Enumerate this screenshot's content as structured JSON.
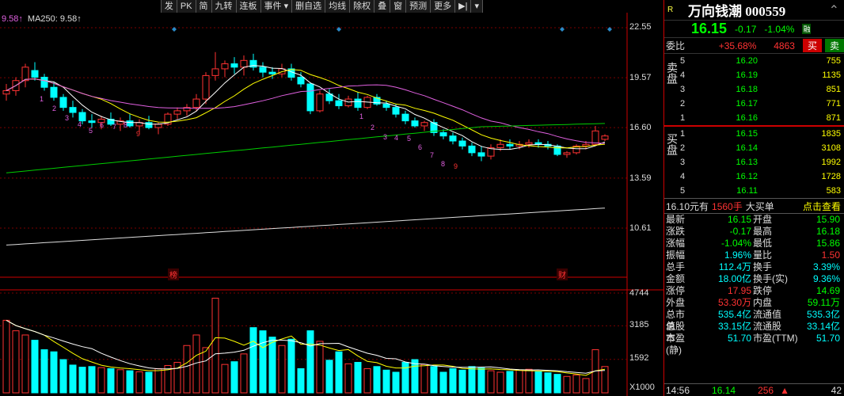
{
  "toolbar": [
    "发",
    "PK",
    "简",
    "九转",
    "连板",
    "事件",
    "删自选",
    "均线",
    "除权",
    "叠",
    "窗",
    "预测",
    "更多"
  ],
  "legend": {
    "ma": "9.58↑",
    "ma250": "MA250: 9.58↑"
  },
  "yaxis_price": [
    "22.55",
    "19.57",
    "16.60",
    "13.59",
    "10.61"
  ],
  "yaxis_vol": [
    "4744",
    "3185",
    "1592",
    "X1000"
  ],
  "markers": {
    "bang": "榜",
    "cai": "财"
  },
  "counts_a": [
    "1",
    "2",
    "3",
    "4",
    "5",
    "6",
    "7",
    "8",
    "9"
  ],
  "counts_b": [
    "1",
    "2",
    "3",
    "4",
    "5",
    "6",
    "7",
    "8",
    "9"
  ],
  "chart_data": {
    "type": "candlestick",
    "candles": [
      [
        18.6,
        19.2,
        18.2,
        18.8
      ],
      [
        18.8,
        19.6,
        18.5,
        19.4
      ],
      [
        19.4,
        20.4,
        19.0,
        20.2
      ],
      [
        20.0,
        20.5,
        19.4,
        19.6
      ],
      [
        19.6,
        19.8,
        18.8,
        19.0
      ],
      [
        19.0,
        19.3,
        18.2,
        18.4
      ],
      [
        18.4,
        18.6,
        17.6,
        17.8
      ],
      [
        17.8,
        18.2,
        17.2,
        17.5
      ],
      [
        17.5,
        17.7,
        16.8,
        17.0
      ],
      [
        17.0,
        17.4,
        16.6,
        16.9
      ],
      [
        16.9,
        17.3,
        16.5,
        17.1
      ],
      [
        17.1,
        17.5,
        16.7,
        16.8
      ],
      [
        16.8,
        17.2,
        16.4,
        17.0
      ],
      [
        17.0,
        17.4,
        16.6,
        16.7
      ],
      [
        16.7,
        17.1,
        16.3,
        16.9
      ],
      [
        16.9,
        17.3,
        16.5,
        16.6
      ],
      [
        16.6,
        16.9,
        16.2,
        16.8
      ],
      [
        16.8,
        17.5,
        16.7,
        17.4
      ],
      [
        17.4,
        17.8,
        17.1,
        17.6
      ],
      [
        17.6,
        18.0,
        17.3,
        17.8
      ],
      [
        17.8,
        18.6,
        17.6,
        18.3
      ],
      [
        18.3,
        19.9,
        18.0,
        19.7
      ],
      [
        19.7,
        21.1,
        19.4,
        20.1
      ],
      [
        20.1,
        20.6,
        19.6,
        20.4
      ],
      [
        20.4,
        20.8,
        19.8,
        20.2
      ],
      [
        20.2,
        20.9,
        19.7,
        20.6
      ],
      [
        20.6,
        21.0,
        20.0,
        20.2
      ],
      [
        20.2,
        20.5,
        19.6,
        19.9
      ],
      [
        19.9,
        20.2,
        19.5,
        19.8
      ],
      [
        19.8,
        20.4,
        19.6,
        20.1
      ],
      [
        20.1,
        20.4,
        19.4,
        19.6
      ],
      [
        19.6,
        19.9,
        19.0,
        19.2
      ],
      [
        19.2,
        19.3,
        17.4,
        17.6
      ],
      [
        17.6,
        18.8,
        17.5,
        18.6
      ],
      [
        18.6,
        18.9,
        18.0,
        18.2
      ],
      [
        18.2,
        18.6,
        17.7,
        17.9
      ],
      [
        17.9,
        18.5,
        17.8,
        18.3
      ],
      [
        18.3,
        18.7,
        17.6,
        17.8
      ],
      [
        17.8,
        18.5,
        17.7,
        18.4
      ],
      [
        18.4,
        18.6,
        17.9,
        18.0
      ],
      [
        18.0,
        18.2,
        17.6,
        17.8
      ],
      [
        17.8,
        18.0,
        17.2,
        17.4
      ],
      [
        17.4,
        17.6,
        16.8,
        17.0
      ],
      [
        17.0,
        17.2,
        16.6,
        16.7
      ],
      [
        16.7,
        17.0,
        16.4,
        16.9
      ],
      [
        16.9,
        17.1,
        16.1,
        16.3
      ],
      [
        16.3,
        16.5,
        15.9,
        16.1
      ],
      [
        16.1,
        16.3,
        15.6,
        15.8
      ],
      [
        15.8,
        16.0,
        15.3,
        15.5
      ],
      [
        15.5,
        15.7,
        14.9,
        15.1
      ],
      [
        15.1,
        15.5,
        14.6,
        14.9
      ],
      [
        14.9,
        15.6,
        14.7,
        15.4
      ],
      [
        15.4,
        15.9,
        15.2,
        15.6
      ],
      [
        15.6,
        15.9,
        15.3,
        15.5
      ],
      [
        15.5,
        15.8,
        15.3,
        15.6
      ],
      [
        15.6,
        15.9,
        15.4,
        15.7
      ],
      [
        15.7,
        15.9,
        15.4,
        15.6
      ],
      [
        15.6,
        15.8,
        15.3,
        15.5
      ],
      [
        15.5,
        15.6,
        14.9,
        15.0
      ],
      [
        15.0,
        15.2,
        14.8,
        15.1
      ],
      [
        15.1,
        15.6,
        15.0,
        15.5
      ],
      [
        15.5,
        15.8,
        15.3,
        15.6
      ],
      [
        15.6,
        16.7,
        15.5,
        16.4
      ],
      [
        15.9,
        16.2,
        15.8,
        16.1
      ]
    ],
    "volumes": [
      3450,
      2950,
      2750,
      2500,
      2050,
      1950,
      1580,
      1320,
      1220,
      1250,
      1200,
      1150,
      1100,
      1050,
      1000,
      980,
      1150,
      1300,
      1450,
      2250,
      2750,
      2150,
      4500,
      1350,
      1480,
      1850,
      3100,
      2950,
      2650,
      2250,
      2550,
      1150,
      2950,
      2450,
      1550,
      1950,
      1380,
      1450,
      1150,
      1250,
      1080,
      980,
      1450,
      1580,
      1350,
      1250,
      980,
      1150,
      1080,
      1250,
      1180,
      1050,
      980,
      1020,
      1080,
      1120,
      1000,
      950,
      880,
      780,
      850,
      680,
      2050,
      1250
    ],
    "ylim": [
      10.61,
      22.55
    ]
  },
  "side": {
    "r_icon": "R",
    "title": "万向钱潮 000559",
    "price": "16.15",
    "change": "-0.17",
    "pct": "-1.04%",
    "rong": "融",
    "weibi_label": "委比",
    "weibi_val": "+35.68%",
    "weicha_val": "4863",
    "buy_btn": "买",
    "sell_btn": "卖",
    "sell_side": "卖盘",
    "buy_side": "买盘",
    "asks": [
      [
        "5",
        "16.20",
        "755"
      ],
      [
        "4",
        "16.19",
        "1135"
      ],
      [
        "3",
        "16.18",
        "851"
      ],
      [
        "2",
        "16.17",
        "771"
      ],
      [
        "1",
        "16.16",
        "871"
      ]
    ],
    "bids": [
      [
        "1",
        "16.15",
        "1835"
      ],
      [
        "2",
        "16.14",
        "3108"
      ],
      [
        "3",
        "16.13",
        "1992"
      ],
      [
        "4",
        "16.12",
        "1728"
      ],
      [
        "5",
        "16.11",
        "583"
      ]
    ],
    "trade_a": "16.10元有",
    "trade_b": "1560手",
    "trade_c": "大买单",
    "trade_d": "点击查看",
    "stats": [
      [
        "最新",
        "16.15",
        "开盘",
        "15.90"
      ],
      [
        "涨跌",
        "-0.17",
        "最高",
        "16.18"
      ],
      [
        "涨幅",
        "-1.04%",
        "最低",
        "15.86"
      ],
      [
        "振幅",
        "1.96%",
        "量比",
        "1.50"
      ],
      [
        "总手",
        "112.4万",
        "换手",
        "3.39%"
      ],
      [
        "金额",
        "18.00亿",
        "换手(实)",
        "9.36%"
      ],
      [
        "涨停",
        "17.95",
        "跌停",
        "14.69"
      ],
      [
        "外盘",
        "53.30万",
        "内盘",
        "59.11万"
      ],
      [
        "总市值",
        "535.4亿",
        "流通值",
        "535.3亿"
      ],
      [
        "总股本",
        "33.15亿",
        "流通股",
        "33.14亿"
      ],
      [
        "市盈(静)",
        "51.70",
        "市盈(TTM)",
        "51.70"
      ]
    ],
    "tick_time": "14:56",
    "tick_price": "16.14",
    "tick_vol": "256",
    "tick_n": "42"
  }
}
